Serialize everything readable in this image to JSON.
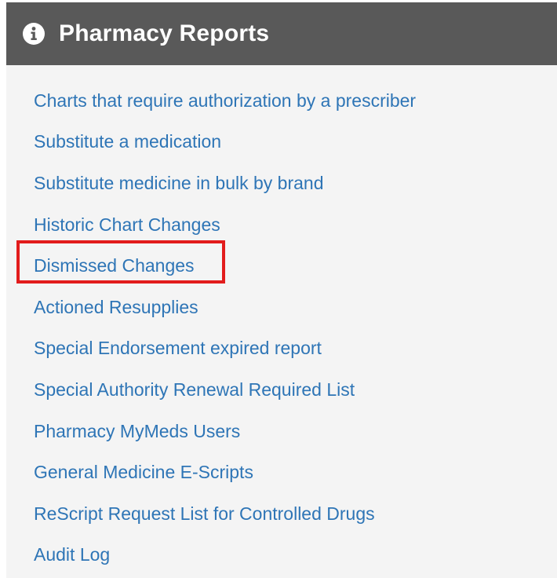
{
  "header": {
    "title": "Pharmacy Reports",
    "icon": "info-circle-icon"
  },
  "links": [
    {
      "label": "Charts that require authorization by a prescriber"
    },
    {
      "label": "Substitute a medication"
    },
    {
      "label": "Substitute medicine in bulk by brand"
    },
    {
      "label": "Historic Chart Changes"
    },
    {
      "label": "Dismissed Changes"
    },
    {
      "label": "Actioned Resupplies"
    },
    {
      "label": "Special Endorsement expired report"
    },
    {
      "label": "Special Authority Renewal Required List"
    },
    {
      "label": "Pharmacy MyMeds Users"
    },
    {
      "label": "General Medicine E-Scripts"
    },
    {
      "label": "ReScript Request List for Controlled Drugs"
    },
    {
      "label": "Audit Log"
    }
  ],
  "highlight": {
    "target": "Dismissed Changes",
    "color": "#e21c1c"
  },
  "colors": {
    "header_bg": "#595959",
    "panel_bg": "#f4f4f4",
    "link": "#2e75b6"
  }
}
